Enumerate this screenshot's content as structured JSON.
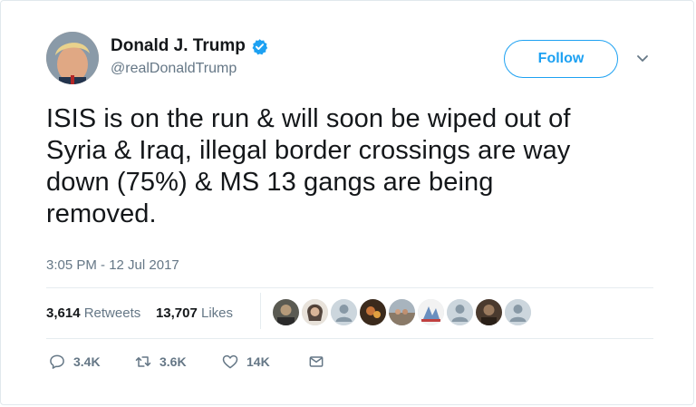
{
  "author": {
    "name": "Donald J. Trump",
    "handle": "@realDonaldTrump",
    "verified": true
  },
  "follow_button": {
    "label": "Follow"
  },
  "tweet": {
    "lines": [
      "ISIS is on the run & will soon be wiped out of",
      "Syria & Iraq, illegal border crossings are way",
      "down (75%) & MS 13 gangs are being",
      "removed."
    ],
    "timestamp": "3:05 PM - 12 Jul 2017"
  },
  "stats": {
    "retweets_count": "3,614",
    "retweets_label": "Retweets",
    "likes_count": "13,707",
    "likes_label": "Likes"
  },
  "actions": {
    "replies": "3.4K",
    "retweets": "3.6K",
    "likes": "14K"
  },
  "colors": {
    "accent": "#1da1f2",
    "text": "#14171a",
    "muted": "#657786",
    "divider": "#e6ecf0"
  }
}
